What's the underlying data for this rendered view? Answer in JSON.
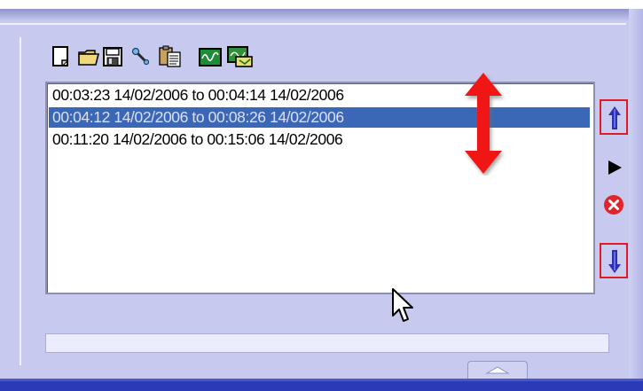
{
  "toolbar": {
    "icons": [
      "new-file-icon",
      "open-folder-icon",
      "save-icon",
      "wrench-icon",
      "clipboard-icon",
      "waveform-icon",
      "export-image-icon"
    ]
  },
  "list": {
    "items": [
      "00:03:23 14/02/2006 to 00:04:14 14/02/2006",
      "00:04:12 14/02/2006 to 00:08:26 14/02/2006",
      "00:11:20 14/02/2006 to 00:15:06 14/02/2006"
    ],
    "selected_index": 1
  },
  "side_controls": {
    "icons": [
      "move-up-icon",
      "play-icon",
      "delete-icon",
      "move-down-icon"
    ]
  },
  "colors": {
    "panel": "#c7c9ee",
    "selection": "#3a68b6",
    "annotation": "#e01b25",
    "move_arrow": "#2b2fb0"
  }
}
